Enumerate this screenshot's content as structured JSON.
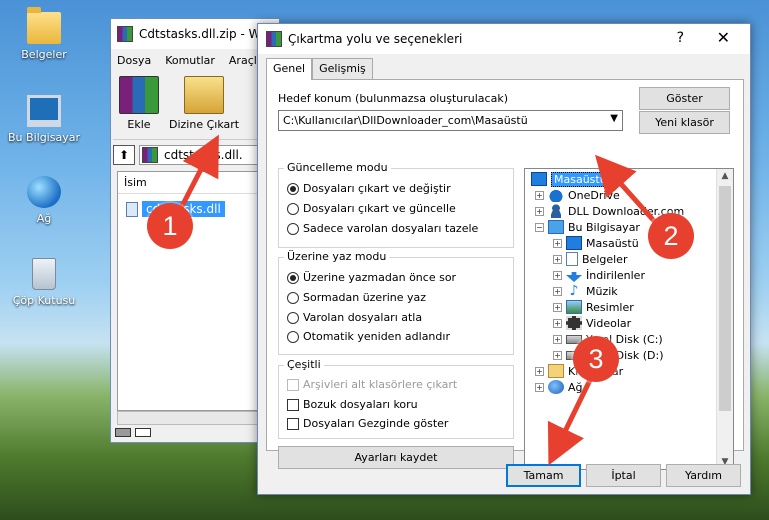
{
  "desktop": {
    "icons": [
      {
        "label": "Belgeler",
        "icon": "folder-icon"
      },
      {
        "label": "Bu Bilgisayar",
        "icon": "computer-icon"
      },
      {
        "label": "Ağ",
        "icon": "network-icon"
      },
      {
        "label": "Çöp Kutusu",
        "icon": "recycle-bin-icon"
      }
    ]
  },
  "winrar": {
    "title": "Cdtstasks.dll.zip - W",
    "menu": [
      "Dosya",
      "Komutlar",
      "Araçla"
    ],
    "toolbar": {
      "add": "Ekle",
      "extract_to": "Dizine Çıkart"
    },
    "address": "cdtstasks.dll.",
    "list_header": "İsim",
    "file": "cdtstasks.dll"
  },
  "dialog": {
    "title": "Çıkartma yolu ve seçenekleri",
    "help": "?",
    "close": "✕",
    "tabs": [
      "Genel",
      "Gelişmiş"
    ],
    "dest_label": "Hedef konum (bulunmazsa oluşturulacak)",
    "dest_value": "C:\\Kullanıcılar\\DllDownloader_com\\Masaüstü",
    "show_btn": "Göster",
    "new_folder_btn": "Yeni klasör",
    "update_mode": {
      "title": "Güncelleme modu",
      "options": [
        "Dosyaları çıkart ve değiştir",
        "Dosyaları çıkart ve güncelle",
        "Sadece varolan dosyaları tazele"
      ],
      "selected": 0
    },
    "overwrite_mode": {
      "title": "Üzerine yaz modu",
      "options": [
        "Üzerine yazmadan önce sor",
        "Sormadan üzerine yaz",
        "Varolan dosyaları atla",
        "Otomatik yeniden adlandır"
      ],
      "selected": 0
    },
    "misc": {
      "title": "Çeşitli",
      "options": [
        "Arşivleri alt klasörlere çıkart",
        "Bozuk dosyaları koru",
        "Dosyaları Gezginde göster"
      ],
      "disabled": [
        true,
        false,
        false
      ]
    },
    "save_settings": "Ayarları kaydet",
    "tree": [
      {
        "label": "Masaüstü",
        "icon": "desktop-icon",
        "level": 0,
        "selected": true,
        "expand": ""
      },
      {
        "label": "OneDrive",
        "icon": "onedrive-icon",
        "level": 1,
        "expand": "+"
      },
      {
        "label": "DLL Downloader.com",
        "icon": "user-icon",
        "level": 1,
        "expand": "+"
      },
      {
        "label": "Bu Bilgisayar",
        "icon": "computer-icon",
        "level": 1,
        "expand": "−"
      },
      {
        "label": "Masaüstü",
        "icon": "desktop-icon",
        "level": 2,
        "expand": "+"
      },
      {
        "label": "Belgeler",
        "icon": "documents-icon",
        "level": 2,
        "expand": "+"
      },
      {
        "label": "İndirilenler",
        "icon": "downloads-icon",
        "level": 2,
        "expand": "+"
      },
      {
        "label": "Müzik",
        "icon": "music-icon",
        "level": 2,
        "expand": "+"
      },
      {
        "label": "Resimler",
        "icon": "pictures-icon",
        "level": 2,
        "expand": "+"
      },
      {
        "label": "Videolar",
        "icon": "videos-icon",
        "level": 2,
        "expand": "+"
      },
      {
        "label": "Yerel Disk (C:)",
        "icon": "drive-icon",
        "level": 2,
        "expand": "+"
      },
      {
        "label": "Yerel Disk (D:)",
        "icon": "drive-icon",
        "level": 2,
        "expand": "+"
      },
      {
        "label": "Kitaplıklar",
        "icon": "libraries-icon",
        "level": 1,
        "expand": "+"
      },
      {
        "label": "Ağ",
        "icon": "network-icon",
        "level": 1,
        "expand": "+"
      }
    ],
    "ok": "Tamam",
    "cancel": "İptal",
    "help_btn": "Yardım"
  },
  "annotations": [
    "1",
    "2",
    "3"
  ],
  "colors": {
    "accent": "#e8402f",
    "selection": "#3399ff"
  }
}
